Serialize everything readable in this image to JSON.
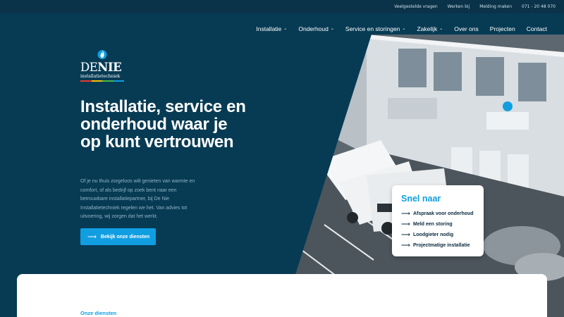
{
  "topbar": {
    "links": [
      "Veelgestelde vragen",
      "Werken bij",
      "Melding maken",
      "071 - 20 48 070"
    ]
  },
  "nav": {
    "items": [
      {
        "label": "Installatie",
        "dropdown": true
      },
      {
        "label": "Onderhoud",
        "dropdown": true
      },
      {
        "label": "Service en storingen",
        "dropdown": true
      },
      {
        "label": "Zakelijk",
        "dropdown": true
      },
      {
        "label": "Over ons",
        "dropdown": false
      },
      {
        "label": "Projecten",
        "dropdown": false
      },
      {
        "label": "Contact",
        "dropdown": false
      }
    ]
  },
  "logo": {
    "brand_light": "DE",
    "brand_bold": "NIE",
    "subtitle": "installatietechniek",
    "icon": "flame-icon",
    "stripe_colors": [
      "#e8392f",
      "#f6c300",
      "#4fb848",
      "#119ee1"
    ]
  },
  "hero": {
    "headline": "Installatie, service en onderhoud waar je op kunt vertrouwen",
    "intro": "Of je nu thuis zorgeloos wilt genieten van warmte en comfort, of als bedrijf op zoek bent naar een betrouwbare installatiepartner, bij De Nie Installatietechniek regelen we het. Van advies tot uitvoering, wij zorgen dat het werkt.",
    "cta_label": "Bekijk onze diensten"
  },
  "snel": {
    "title": "Snel naar",
    "items": [
      "Afspraak voor onderhoud",
      "Meld een storing",
      "Loodgieter nodig",
      "Projectmatige installatie"
    ]
  },
  "card": {
    "eyebrow": "Onze diensten"
  },
  "colors": {
    "background": "#073b54",
    "topbar": "#0a3249",
    "accent": "#119ee1",
    "intro_text": "#8fb3c6"
  }
}
